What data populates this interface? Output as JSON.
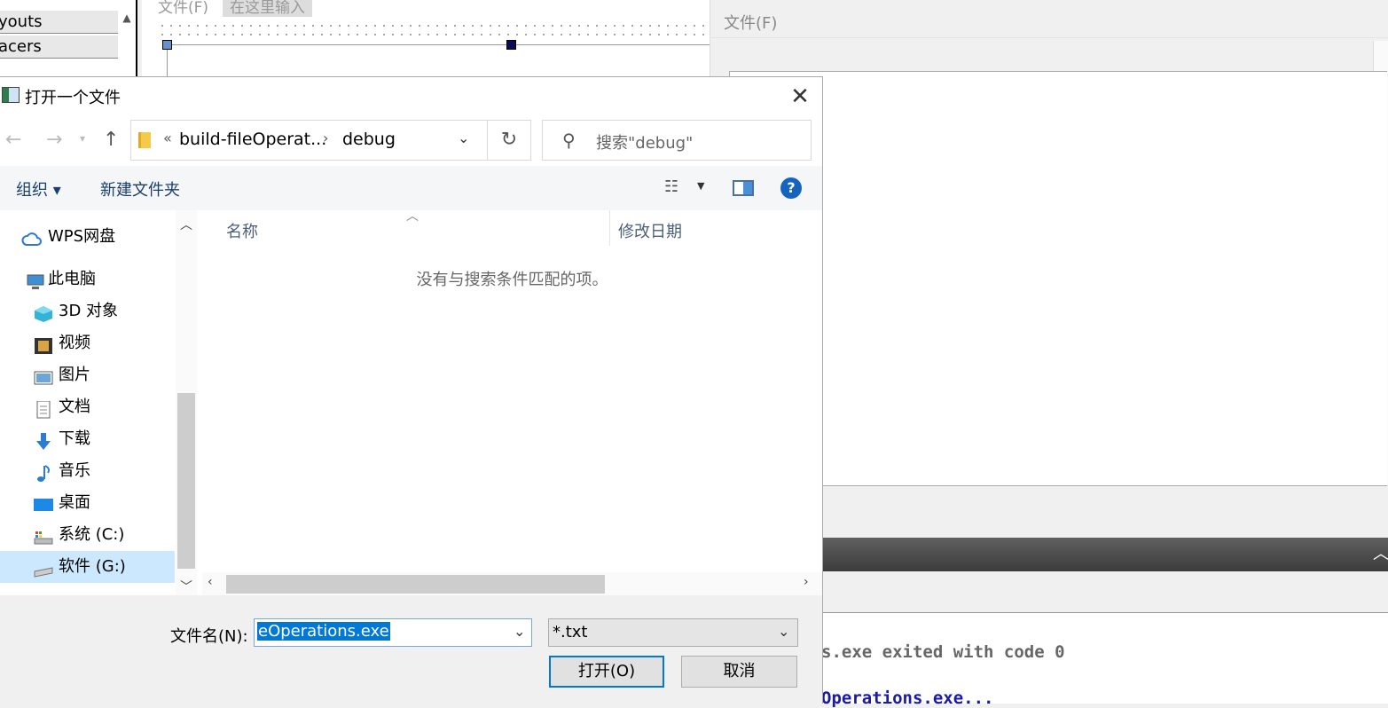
{
  "background": {
    "widget_box": {
      "items": [
        "youts",
        "acers"
      ]
    },
    "designer": {
      "menu_file": "文件(F)",
      "menu_typehere": "在这里输入"
    },
    "right_window": {
      "menu_file": "文件(F)"
    },
    "output": {
      "line1": "s.exe exited with code 0",
      "line2": "Operations.exe..."
    }
  },
  "dialog": {
    "title": "打开一个文件",
    "address": {
      "segment1": "build-fileOperat...",
      "segment2": "debug"
    },
    "search": {
      "placeholder": "搜索\"debug\""
    },
    "toolbar": {
      "organize": "组织 ▾",
      "new_folder": "新建文件夹"
    },
    "nav": {
      "items": [
        {
          "label": "WPS网盘",
          "icon": "cloud-icon"
        },
        {
          "label": "此电脑",
          "icon": "computer-icon"
        },
        {
          "label": "3D 对象",
          "icon": "3d-objects-icon"
        },
        {
          "label": "视频",
          "icon": "video-icon"
        },
        {
          "label": "图片",
          "icon": "pictures-icon"
        },
        {
          "label": "文档",
          "icon": "documents-icon"
        },
        {
          "label": "下载",
          "icon": "download-icon"
        },
        {
          "label": "音乐",
          "icon": "music-icon"
        },
        {
          "label": "桌面",
          "icon": "desktop-icon"
        },
        {
          "label": "系统 (C:)",
          "icon": "drive-c-icon"
        },
        {
          "label": "软件 (G:)",
          "icon": "drive-g-icon"
        }
      ],
      "selected": "软件 (G:)"
    },
    "columns": {
      "name": "名称",
      "date": "修改日期"
    },
    "empty_message": "没有与搜索条件匹配的项。",
    "filename": {
      "label": "文件名(N):",
      "value": "eOperations.exe"
    },
    "filter": {
      "value": "*.txt"
    },
    "buttons": {
      "open": "打开(O)",
      "cancel": "取消"
    },
    "colors": {
      "accent": "#0078d7",
      "selection": "#cce8ff"
    }
  }
}
